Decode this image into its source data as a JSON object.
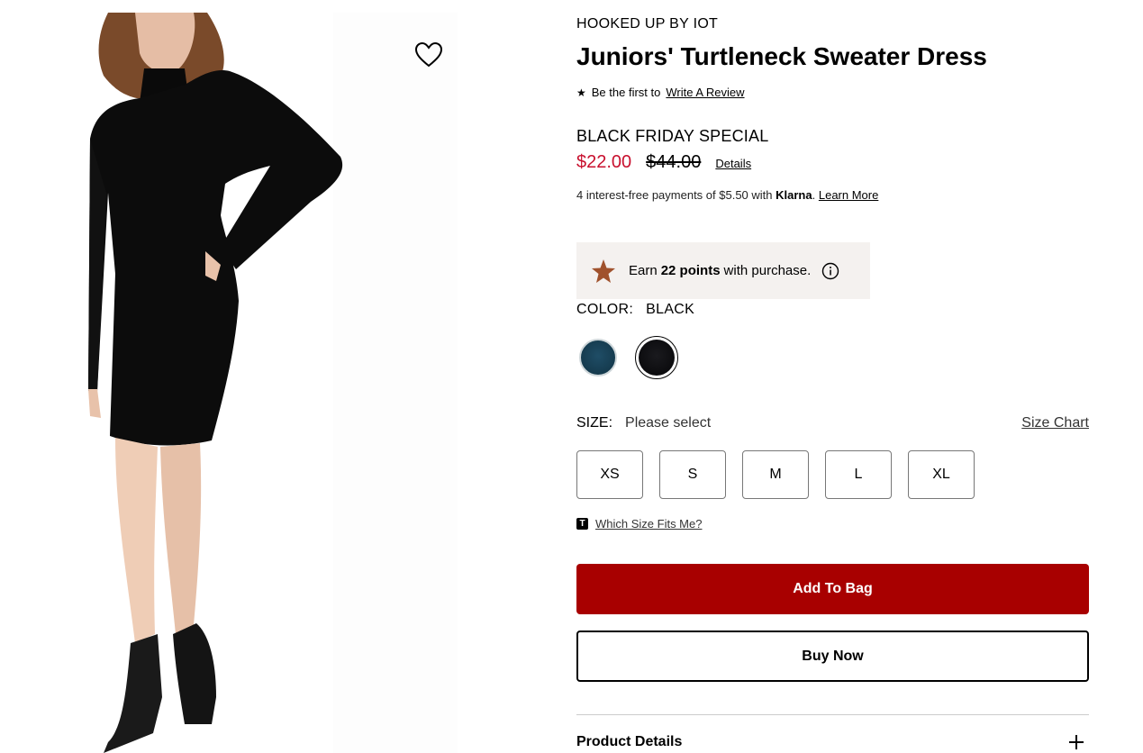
{
  "product": {
    "brand": "HOOKED UP BY IOT",
    "title": "Juniors' Turtleneck Sweater Dress",
    "review_prefix": "Be the first to",
    "review_link": "Write A Review",
    "promo_label": "BLACK FRIDAY SPECIAL",
    "sale_price": "$22.00",
    "original_price": "$44.00",
    "details_link": "Details",
    "klarna_text": "4 interest-free payments of $5.50 with",
    "klarna_brand": "Klarna",
    "klarna_period": ".",
    "klarna_link": "Learn More"
  },
  "points": {
    "prefix": "Earn",
    "amount": "22 points",
    "suffix": "with purchase."
  },
  "color": {
    "label": "COLOR:",
    "selected": "BLACK",
    "swatches": [
      {
        "name": "teal",
        "hex": "#1f4d66"
      },
      {
        "name": "black",
        "hex": "#0a0a0c"
      }
    ]
  },
  "size": {
    "label": "SIZE:",
    "selected": "Please select",
    "chart_link": "Size Chart",
    "options": [
      "XS",
      "S",
      "M",
      "L",
      "XL"
    ],
    "fit_link": "Which Size Fits Me?",
    "fit_icon": "T"
  },
  "actions": {
    "add_to_bag": "Add To Bag",
    "buy_now": "Buy Now"
  },
  "sections": {
    "product_details": "Product Details"
  },
  "colors": {
    "sale_red": "#c8102e",
    "add_bag_bg": "#a80000",
    "points_bg": "#f4f1ef",
    "points_star": "#a0522d"
  }
}
